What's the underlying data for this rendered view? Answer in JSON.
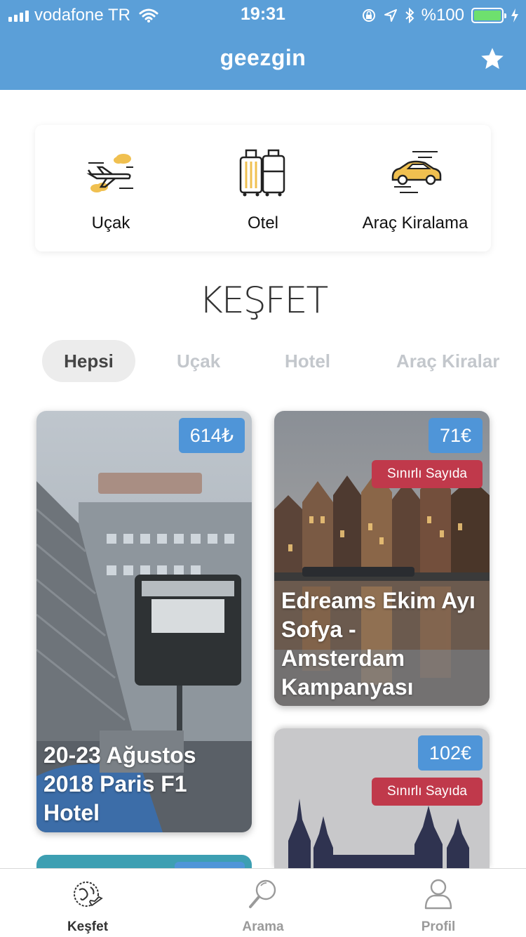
{
  "status_bar": {
    "carrier": "vodafone TR",
    "time": "19:31",
    "battery": "%100"
  },
  "header": {
    "title": "geezgin",
    "favorite_icon": "star-icon"
  },
  "services": [
    {
      "label": "Uçak",
      "icon": "airplane-icon"
    },
    {
      "label": "Otel",
      "icon": "luggage-icon"
    },
    {
      "label": "Araç Kiralama",
      "icon": "car-icon"
    }
  ],
  "section_title": "KEŞFET",
  "filters": [
    {
      "label": "Hepsi",
      "active": true
    },
    {
      "label": "Uçak",
      "active": false
    },
    {
      "label": "Hotel",
      "active": false
    },
    {
      "label": "Araç Kiralar",
      "active": false
    }
  ],
  "deals": [
    {
      "price": "614₺",
      "title": "20-23  Ağustos 2018 Paris F1 Hotel",
      "badge": ""
    },
    {
      "price": "71€",
      "title": "Edreams Ekim Ayı Sofya - Amsterdam Kampanyası",
      "badge": "Sınırlı Sayıda"
    },
    {
      "price": "102€",
      "title": "",
      "badge": "Sınırlı Sayıda"
    }
  ],
  "tabs": [
    {
      "label": "Keşfet",
      "icon": "globe-icon",
      "active": true
    },
    {
      "label": "Arama",
      "icon": "search-icon",
      "active": false
    },
    {
      "label": "Profil",
      "icon": "profile-icon",
      "active": false
    }
  ],
  "colors": {
    "primary": "#5b9fd8",
    "price_badge": "#4f95d8",
    "limited_badge": "#c0394b"
  }
}
